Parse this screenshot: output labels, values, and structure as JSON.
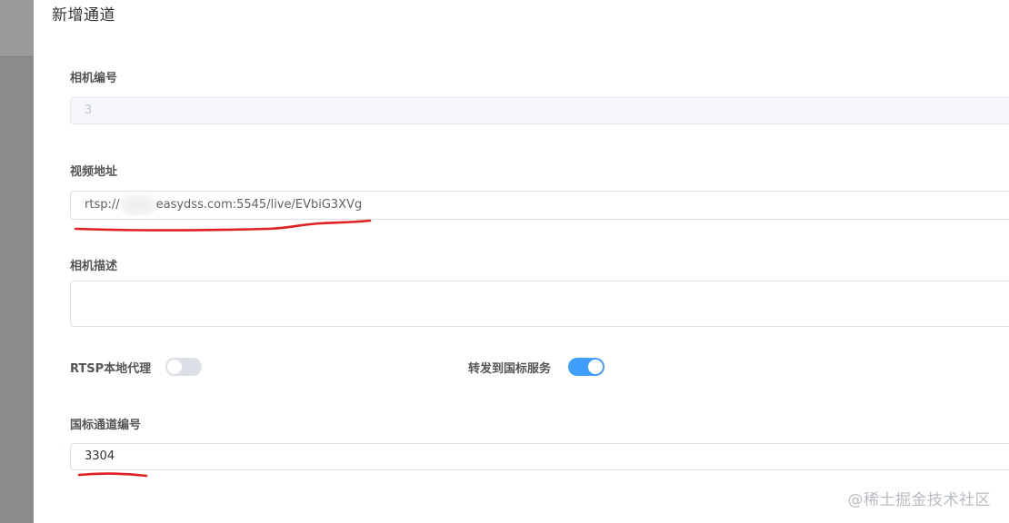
{
  "dialog": {
    "title": "新增通道"
  },
  "form": {
    "camera_id": {
      "label": "相机编号",
      "value": "3"
    },
    "video_url": {
      "label": "视频地址",
      "prefix": "rtsp://",
      "suffix": "easydss.com:5545/live/EVbiG3XVg"
    },
    "camera_desc": {
      "label": "相机描述",
      "value": ""
    },
    "rtsp_proxy": {
      "label": "RTSP本地代理",
      "enabled": false
    },
    "gb_forward": {
      "label": "转发到国标服务",
      "enabled": true
    },
    "gb_channel_id": {
      "label": "国标通道编号",
      "value": "3304"
    }
  },
  "annotation_color": "#e02020",
  "switch_on_color": "#409eff",
  "watermark": "@稀土掘金技术社区"
}
